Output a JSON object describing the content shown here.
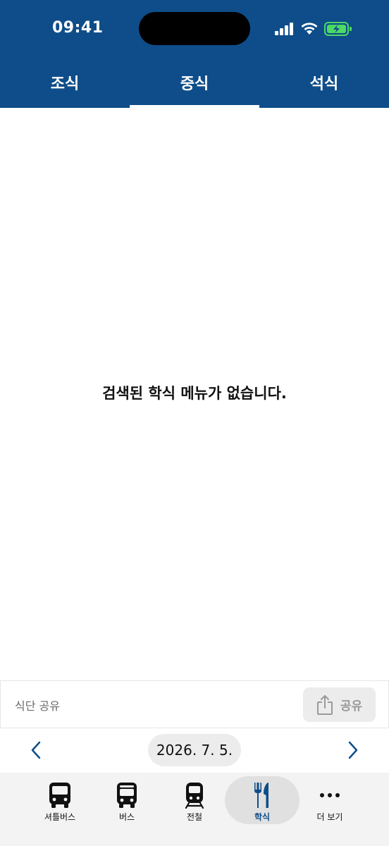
{
  "status_bar": {
    "time": "09:41"
  },
  "colors": {
    "primary": "#0e4d89",
    "battery": "#4cd964"
  },
  "tabs": [
    {
      "label": "조식",
      "selected": false
    },
    {
      "label": "중식",
      "selected": true
    },
    {
      "label": "석식",
      "selected": false
    }
  ],
  "empty_state": {
    "message": "검색된 학식 메뉴가 없습니다."
  },
  "share": {
    "label": "식단 공유",
    "button_label": "공유",
    "button_icon": "share-icon"
  },
  "date_nav": {
    "date": "2026. 7. 5.",
    "prev_icon": "chevron-left-icon",
    "next_icon": "chevron-right-icon"
  },
  "bottom_nav": [
    {
      "label": "셔틀버스",
      "icon": "shuttle-bus-icon",
      "active": false
    },
    {
      "label": "버스",
      "icon": "bus-icon",
      "active": false
    },
    {
      "label": "전철",
      "icon": "train-icon",
      "active": false
    },
    {
      "label": "학식",
      "icon": "fork-knife-icon",
      "active": true
    },
    {
      "label": "더 보기",
      "icon": "more-icon",
      "active": false
    }
  ]
}
